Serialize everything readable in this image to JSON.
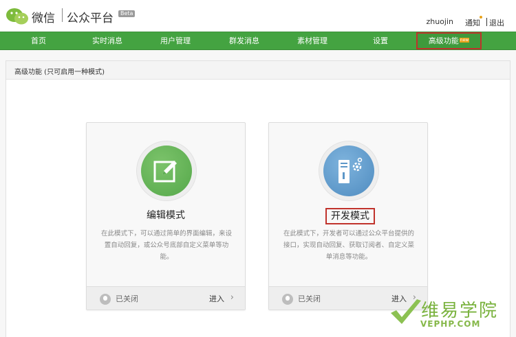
{
  "header": {
    "app_name": "微信",
    "platform_name": "公众平台",
    "beta_badge": "Beta",
    "username": "zhuojin",
    "notice_label": "通知",
    "logout_label": "退出"
  },
  "nav": {
    "items": [
      {
        "label": "首页"
      },
      {
        "label": "实时消息"
      },
      {
        "label": "用户管理"
      },
      {
        "label": "群发消息"
      },
      {
        "label": "素材管理"
      },
      {
        "label": "设置"
      },
      {
        "label": "高级功能",
        "badge": "new"
      }
    ]
  },
  "panel": {
    "title": "高级功能 (只可启用一种模式)"
  },
  "modes": [
    {
      "title": "编辑模式",
      "description": "在此模式下，可以通过简单的界面编辑，来设置自动回复，或公众号底部自定义菜单等功能。",
      "status": "已关闭",
      "enter_label": "进入",
      "icon": "edit-icon"
    },
    {
      "title": "开发模式",
      "description": "在此模式下，开发者可以通过公众平台提供的接口，实现自动回复、获取订阅者、自定义菜单消息等功能。",
      "status": "已关闭",
      "enter_label": "进入",
      "icon": "server-gear-icon"
    }
  ],
  "watermark": {
    "text": "维易学院",
    "url": "VEPHP.COM"
  },
  "colors": {
    "nav_green": "#44a341",
    "highlight_red": "#c0322b",
    "edit_circle": "#5fae52",
    "dev_circle": "#5c97c8"
  }
}
